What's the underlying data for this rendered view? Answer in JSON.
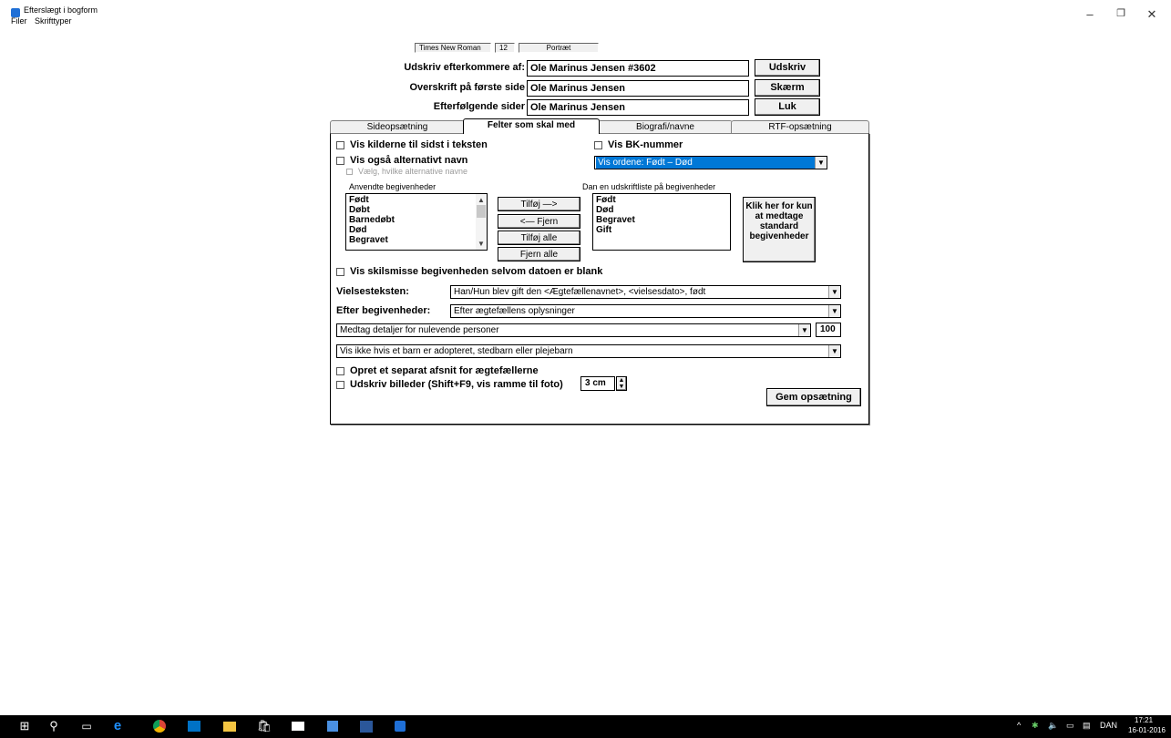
{
  "window": {
    "title": "Efterslægt i bogform",
    "menu": [
      "Filer",
      "Skrifttyper"
    ],
    "controls": [
      "–",
      "❐",
      "✕"
    ]
  },
  "fontbar": {
    "font": "Times New Roman",
    "size": "12",
    "orientation": "Portræt"
  },
  "header": {
    "descendants_label": "Udskriv efterkommere af:",
    "descendants_value": "Ole Marinus Jensen  #3602",
    "first_page_label": "Overskrift på første side",
    "first_page_value": "Ole Marinus Jensen",
    "following_label": "Efterfølgende sider",
    "following_value": "Ole Marinus Jensen",
    "print_button": "Udskriv",
    "screen_button": "Skærm",
    "close_button": "Luk"
  },
  "tabs": [
    "Sideopsætning",
    "Felter som skal med",
    "Biografi/navne",
    "RTF-opsætning"
  ],
  "tab_panel": {
    "chk_sources": "Vis kilderne til sidst i teksten",
    "chk_bk": "Vis BK-nummer",
    "chk_altname": "Vis også alternativt navn",
    "chk_choose_alt": "Vælg, hvilke alternative navne",
    "order_combo": "Vis ordene: Født – Død",
    "used_events_label": "Anvendte begivenheder",
    "used_events": [
      "Født",
      "Døbt",
      "Barnedøbt",
      "Død",
      "Begravet"
    ],
    "add_button": "Tilføj —>",
    "remove_button": "<— Fjern",
    "add_all_button": "Tilføj alle",
    "remove_all_button": "Fjern alle",
    "print_list_label": "Dan en udskriftliste på begivenheder",
    "print_list": [
      "Født",
      "Død",
      "Begravet",
      "Gift"
    ],
    "standard_button": "Klik her for kun at medtage standard begivenheder",
    "chk_divorce": "Vis skilsmisse begivenheden selvom datoen er blank",
    "marriage_label": "Vielsesteksten:",
    "marriage_value": "Han/Hun blev gift den <Ægtefællenavnet>, <vielsesdato>, født",
    "after_events_label": "Efter begivenheder:",
    "after_events_value": "Efter ægtefællens oplysninger",
    "living_value": "Medtag detaljer for nulevende personer",
    "living_number": "100",
    "adopted_value": "Vis ikke hvis et barn er adopteret, stedbarn eller plejebarn",
    "chk_separate": "Opret et separat afsnit for ægtefællerne",
    "chk_images": "Udskriv billeder (Shift+F9, vis ramme til foto)",
    "image_size": "3 cm",
    "save_button": "Gem opsætning"
  },
  "taskbar": {
    "language": "DAN",
    "time": "17:21",
    "date": "16-01-2016",
    "tray_chevron": "^"
  },
  "colors": {
    "selection": "#0078d7",
    "taskbar": "#000000",
    "dialog": "#f0f0f0"
  }
}
